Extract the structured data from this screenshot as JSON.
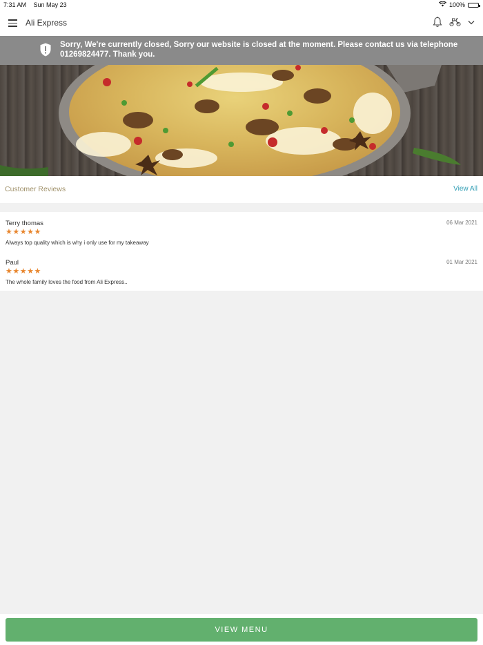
{
  "status_bar": {
    "time": "7:31 AM",
    "date": "Sun May 23",
    "battery": "100%",
    "icons": [
      "wifi-icon",
      "battery-icon"
    ]
  },
  "header": {
    "title": "Ali Express",
    "icons": [
      "menu-icon",
      "bell-icon",
      "scooter-icon",
      "chevron-down-icon"
    ]
  },
  "banner": {
    "icon": "shield-exclamation-icon",
    "message": "Sorry, We're currently closed, Sorry our website is closed at the moment. Please contact us via telephone 01269824477. Thank you."
  },
  "reviews": {
    "heading": "Customer Reviews",
    "view_all": "View All",
    "items": [
      {
        "name": "Terry thomas",
        "date": "06 Mar 2021",
        "stars": "★★★★★",
        "rating": 5,
        "text": "Always top quality which is why i only use  for my takeaway"
      },
      {
        "name": "Paul",
        "date": "01 Mar 2021",
        "stars": "★★★★★",
        "rating": 5,
        "text": "The whole family loves the food from Ali Express.."
      }
    ]
  },
  "footer": {
    "view_menu": "VIEW MENU"
  },
  "colors": {
    "banner_bg": "#8a8a8a",
    "accent_button": "#62b06e",
    "link": "#2d9cb3",
    "star": "#e8862e",
    "heading_gold": "#a0916a"
  }
}
